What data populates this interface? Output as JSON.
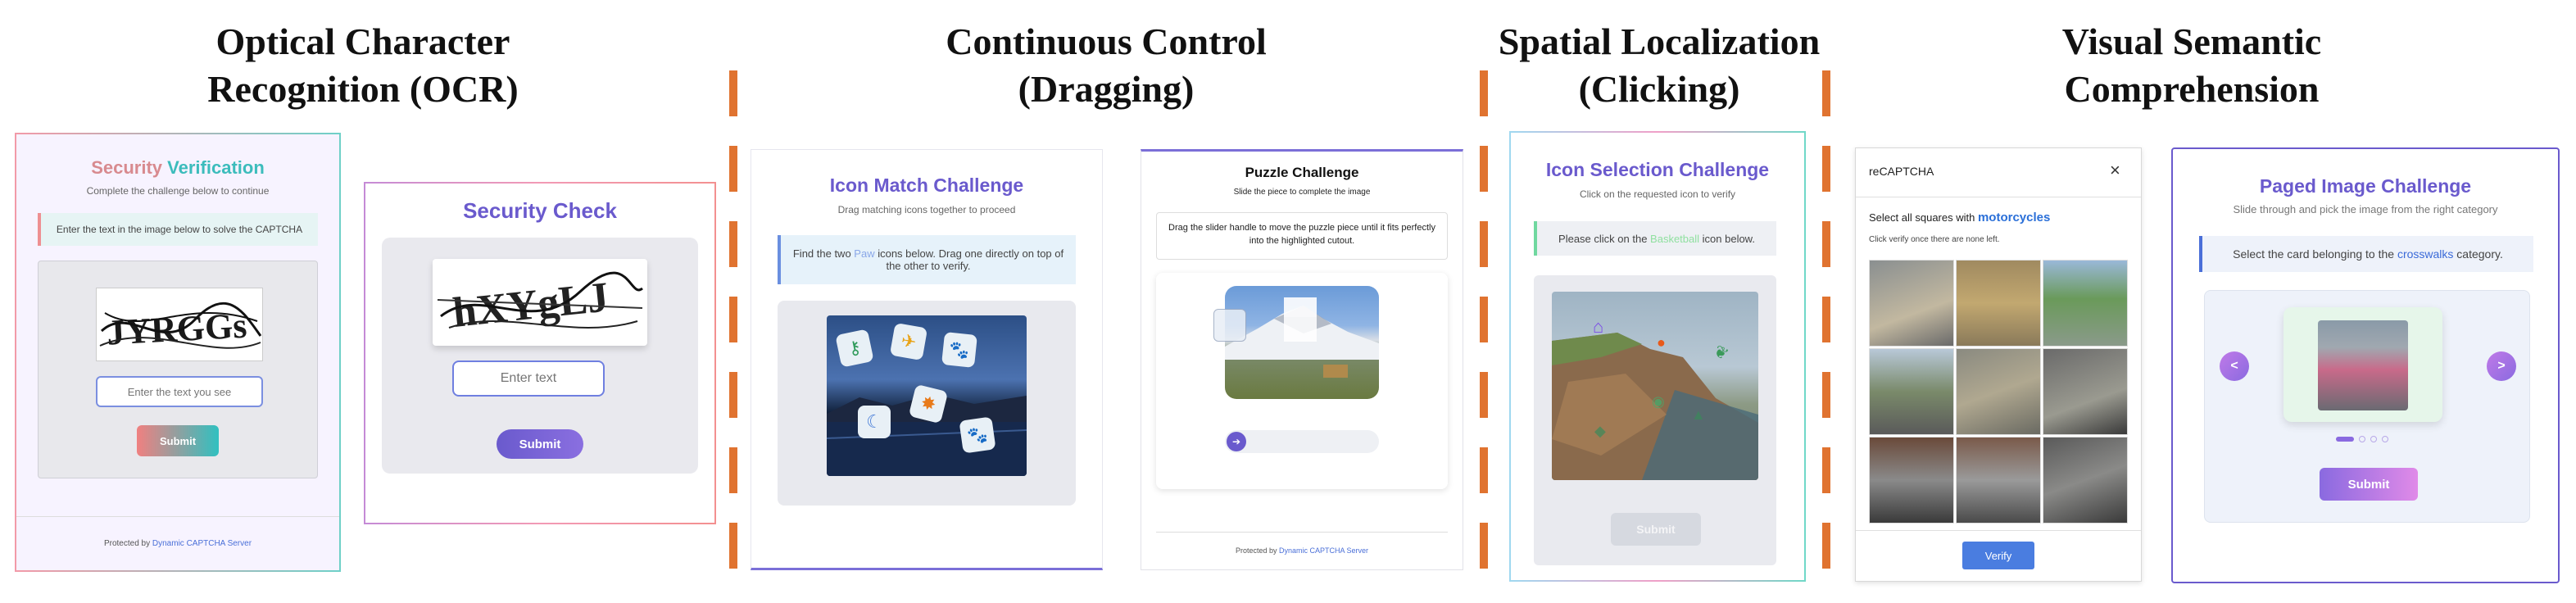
{
  "section_titles": {
    "ocr": [
      "Optical Character",
      "Recognition (OCR)"
    ],
    "drag": [
      "Continuous Control",
      "(Dragging)"
    ],
    "click": [
      "Spatial Localization",
      "(Clicking)"
    ],
    "semantic": [
      "Visual Semantic",
      "Comprehension"
    ]
  },
  "ocr1": {
    "title_a": "Security",
    "title_b": "Verification",
    "subtitle": "Complete the challenge below to continue",
    "instruction": "Enter the text in the image below to solve the CAPTCHA",
    "captcha_text": "JYRGGs",
    "placeholder": "Enter the text you see",
    "submit": "Submit",
    "footer_prefix": "Protected by ",
    "footer_link": "Dynamic CAPTCHA Server"
  },
  "ocr2": {
    "title": "Security Check",
    "captcha_text": "hXYgLJ",
    "placeholder": "Enter text",
    "submit": "Submit"
  },
  "icon_match": {
    "title": "Icon Match Challenge",
    "subtitle": "Drag matching icons together to proceed",
    "instruction_a": "Find the two ",
    "instruction_highlight": "Paw",
    "instruction_b": " icons below. Drag one directly on top of the other to verify."
  },
  "puzzle": {
    "title": "Puzzle Challenge",
    "subtitle": "Slide the piece to complete the image",
    "instruction": "Drag the slider handle to move the puzzle piece until it fits perfectly into the highlighted cutout.",
    "footer_prefix": "Protected by ",
    "footer_link": "Dynamic CAPTCHA Server"
  },
  "icon_select": {
    "title": "Icon Selection Challenge",
    "subtitle": "Click on the requested icon to verify",
    "instruction_a": "Please click on the ",
    "instruction_highlight": "Basketball",
    "instruction_b": " icon below.",
    "submit": "Submit"
  },
  "recaptcha": {
    "header": "reCAPTCHA",
    "close": "×",
    "prompt_a": "Select all squares with ",
    "prompt_highlight": "motorcycles",
    "hint": "Click verify once there are none left.",
    "verify": "Verify"
  },
  "paged": {
    "title": "Paged Image Challenge",
    "subtitle": "Slide through and pick the image from the right category",
    "instruction_a": "Select the card belonging to the ",
    "instruction_highlight": "crosswalks",
    "instruction_b": " category.",
    "prev": "<",
    "next": ">",
    "submit": "Submit"
  },
  "colors": {
    "dash": "#e07330",
    "purple": "#6a5acd",
    "teal": "#3cc0c0",
    "blue_btn": "#4a7de0"
  }
}
